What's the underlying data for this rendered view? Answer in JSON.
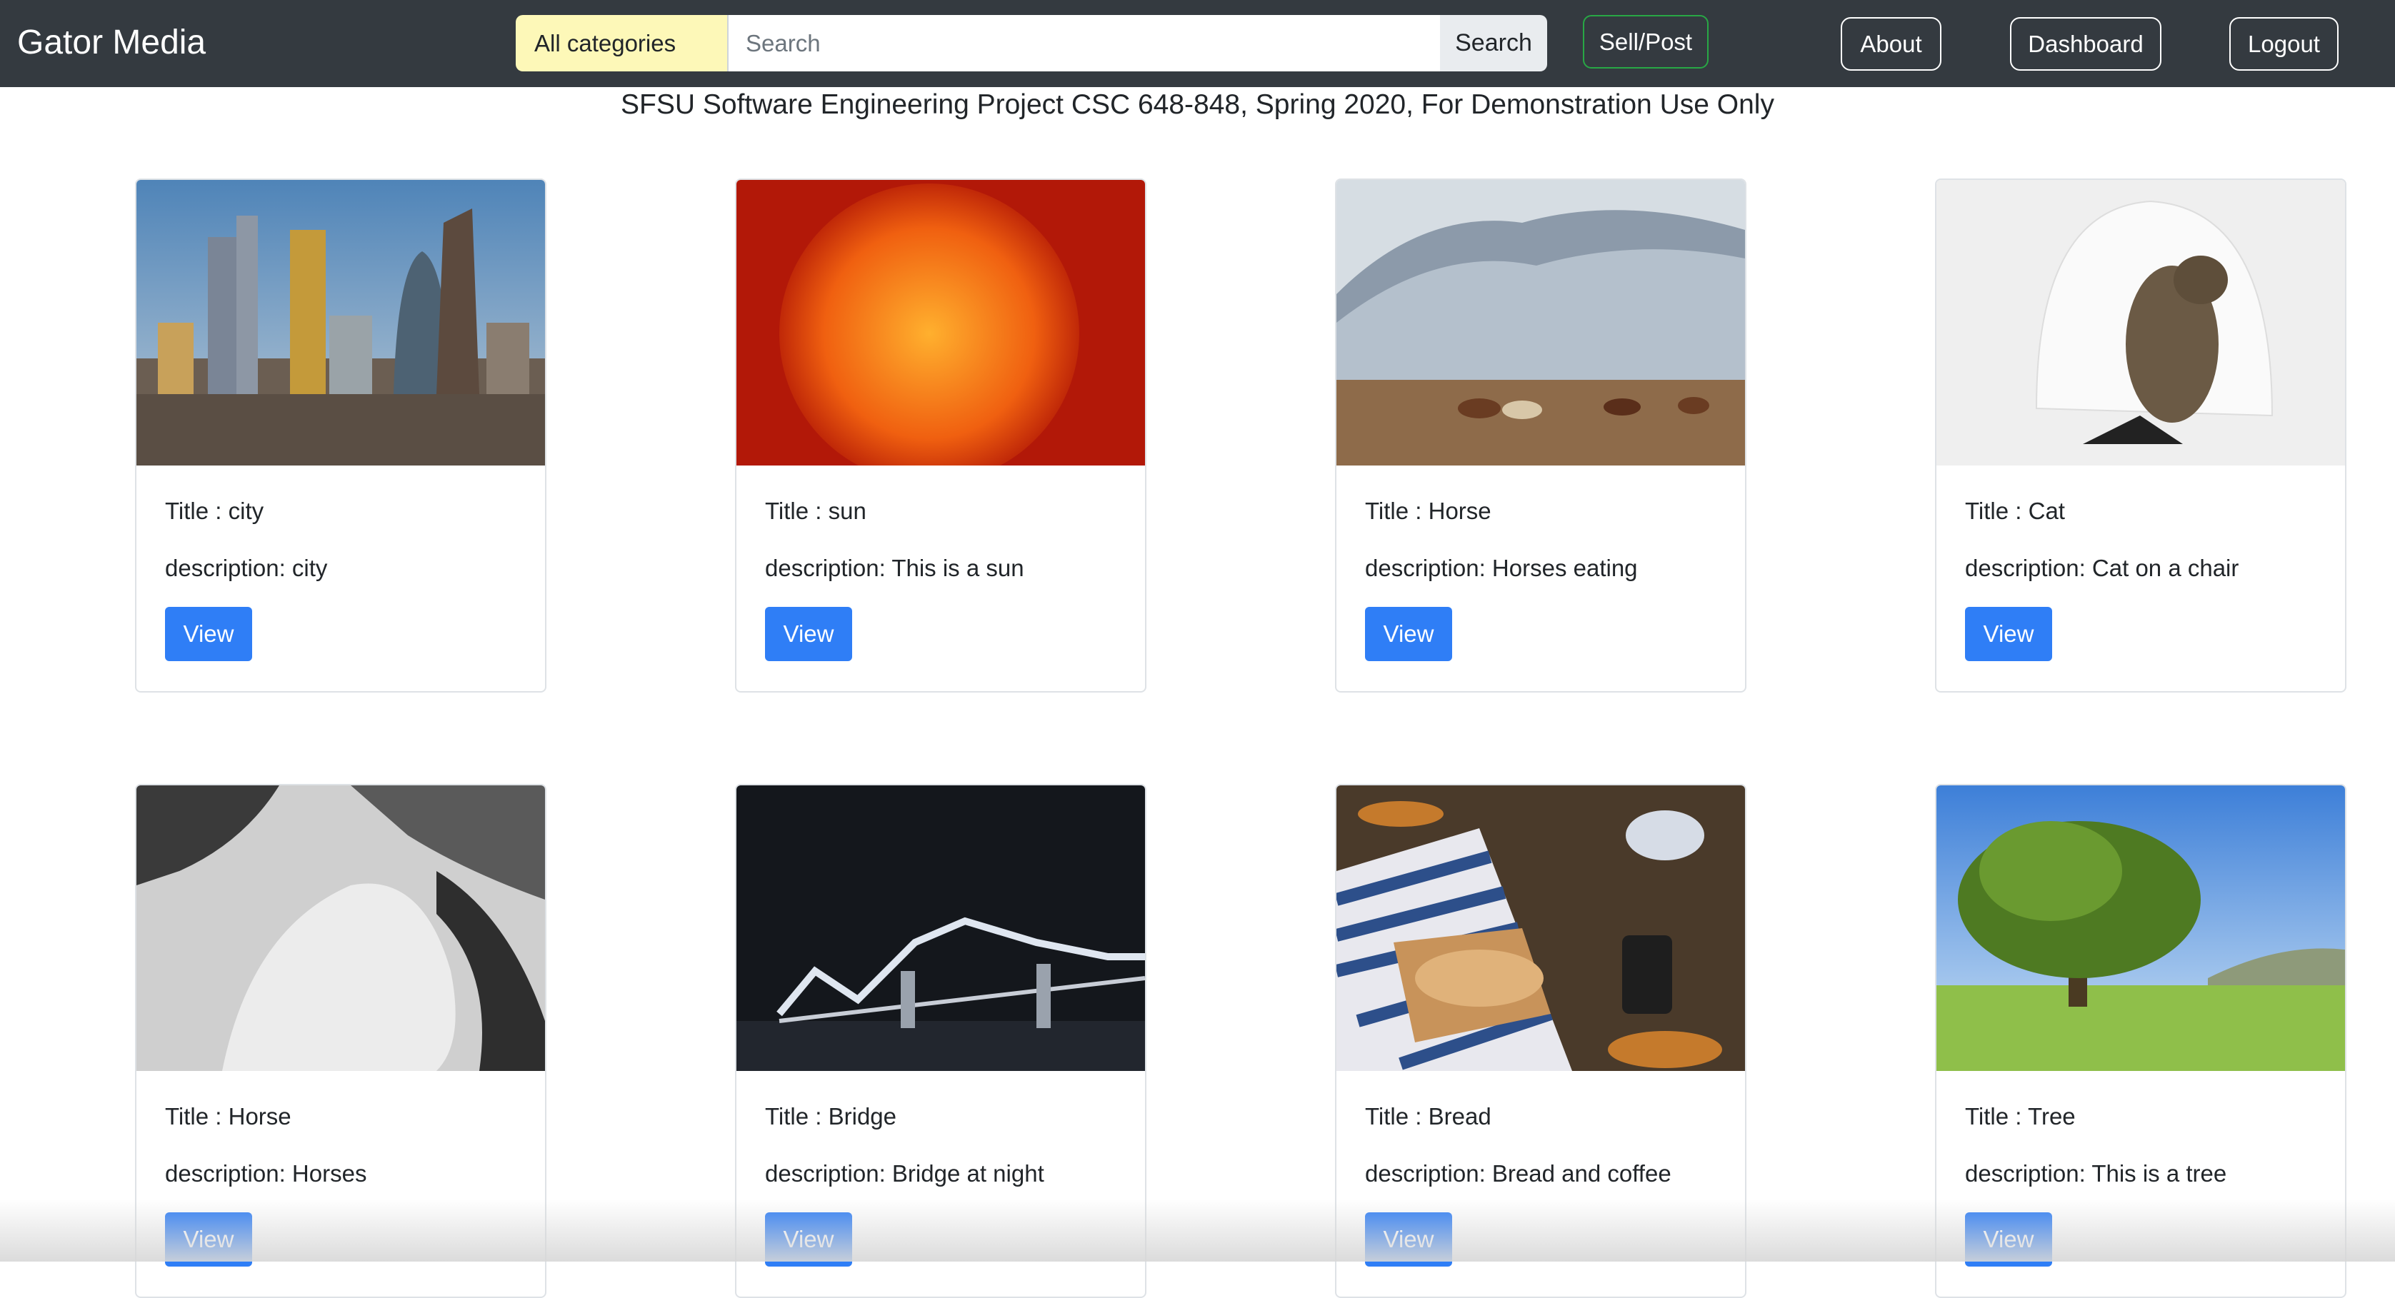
{
  "navbar": {
    "brand": "Gator Media",
    "category_select": "All categories",
    "search_placeholder": "Search",
    "search_button": "Search",
    "sell_button": "Sell/Post",
    "about": "About",
    "dashboard": "Dashboard",
    "logout": "Logout"
  },
  "subtitle": "SFSU Software Engineering Project CSC 648-848, Spring 2020, For Demonstration Use Only",
  "cards": [
    {
      "title": "Title : city",
      "description": "description: city",
      "button": "View",
      "image": "city-skyline-photo"
    },
    {
      "title": "Title : sun",
      "description": "description: This is a sun",
      "button": "View",
      "image": "sun-photo"
    },
    {
      "title": "Title : Horse",
      "description": "description: Horses eating",
      "button": "View",
      "image": "horses-mountain-photo"
    },
    {
      "title": "Title : Cat",
      "description": "description: Cat on a chair",
      "button": "View",
      "image": "cat-chair-photo"
    },
    {
      "title": "Title : Horse",
      "description": "description: Horses",
      "button": "View",
      "image": "horses-bw-photo"
    },
    {
      "title": "Title : Bridge",
      "description": "description: Bridge at night",
      "button": "View",
      "image": "bridge-night-photo"
    },
    {
      "title": "Title : Bread",
      "description": "description: Bread and coffee",
      "button": "View",
      "image": "bread-coffee-photo"
    },
    {
      "title": "Title : Tree",
      "description": "description: This is a tree",
      "button": "View",
      "image": "tree-photo"
    }
  ],
  "colors": {
    "navbar": "#343a40",
    "primary_button": "#2f7ef6",
    "select_highlight": "#fdf8b8",
    "sell_border": "#28a745"
  }
}
